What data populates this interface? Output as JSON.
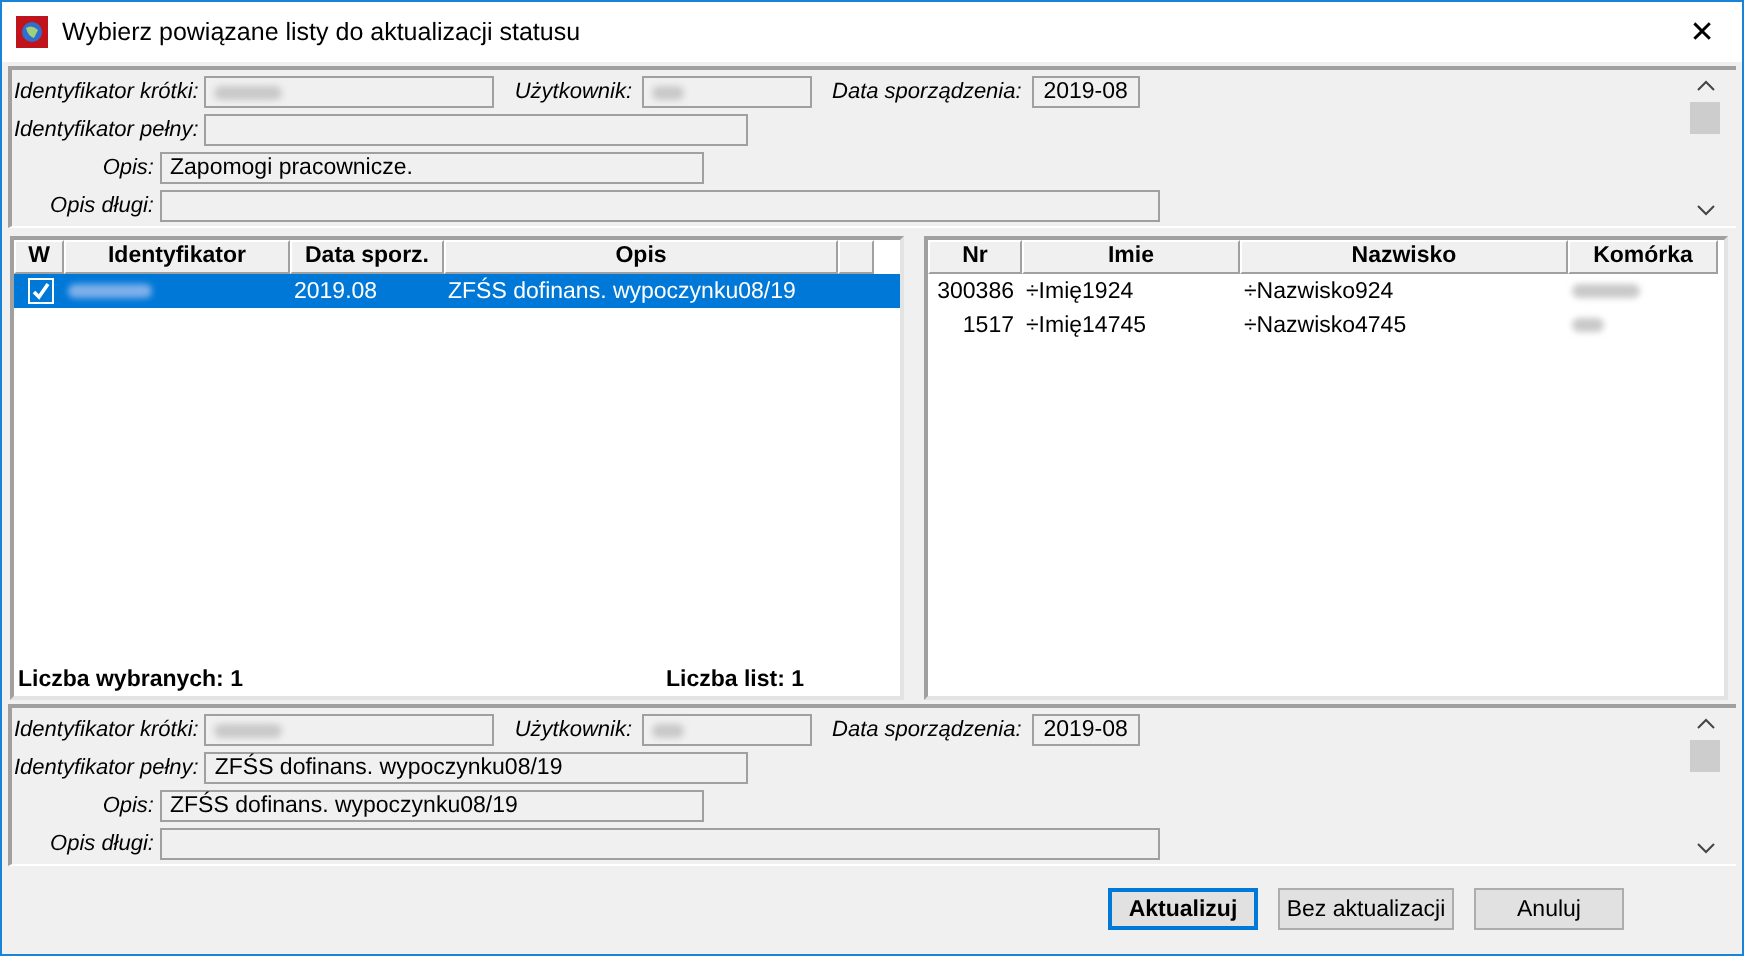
{
  "window": {
    "title": "Wybierz powiązane listy do aktualizacji statusu",
    "close": "✕"
  },
  "panels": [
    {
      "id_short": {
        "label": "Identyfikator krótki:",
        "blurred": true
      },
      "user": {
        "label": "Użytkownik:",
        "blurred": true
      },
      "date": {
        "label": "Data sporządzenia:",
        "value": "2019-08"
      },
      "id_full": {
        "label": "Identyfikator pełny:"
      },
      "opis": {
        "label": "Opis:",
        "value": "Zapomogi pracownicze."
      },
      "opis_long": {
        "label": "Opis długi:"
      }
    },
    {
      "id_short": {
        "label": "Identyfikator krótki:",
        "blurred": true
      },
      "user": {
        "label": "Użytkownik:",
        "blurred": true
      },
      "date": {
        "label": "Data sporządzenia:",
        "value": "2019-08"
      },
      "id_full": {
        "label": "Identyfikator pełny:",
        "value": "ZFŚS dofinans. wypoczynku08/19"
      },
      "opis": {
        "label": "Opis:",
        "value": "ZFŚS dofinans. wypoczynku08/19"
      },
      "opis_long": {
        "label": "Opis długi:"
      }
    }
  ],
  "lists_table": {
    "columns": [
      "W",
      "Identyfikator",
      "Data sporz.",
      "Opis"
    ],
    "rows": [
      {
        "checked": true,
        "selected": true,
        "id_blurred": true,
        "date": "2019.08",
        "opis": "ZFŚS dofinans. wypoczynku08/19"
      }
    ],
    "selected_count": "Liczba wybranych: 1",
    "list_count": "Liczba list: 1"
  },
  "people_table": {
    "columns": [
      "Nr",
      "Imie",
      "Nazwisko",
      "Komórka"
    ],
    "rows": [
      {
        "nr": "300386",
        "imie": "÷Imię1924",
        "nazwisko": "÷Nazwisko924",
        "komorka_blurred": true
      },
      {
        "nr": "1517",
        "imie": "÷Imię14745",
        "nazwisko": "÷Nazwisko4745",
        "komorka_blurred": true
      }
    ]
  },
  "buttons": [
    {
      "label": "Aktualizuj",
      "default": true
    },
    {
      "label": "Bez aktualizacji",
      "default": false
    },
    {
      "label": "Anuluj",
      "default": false
    }
  ]
}
